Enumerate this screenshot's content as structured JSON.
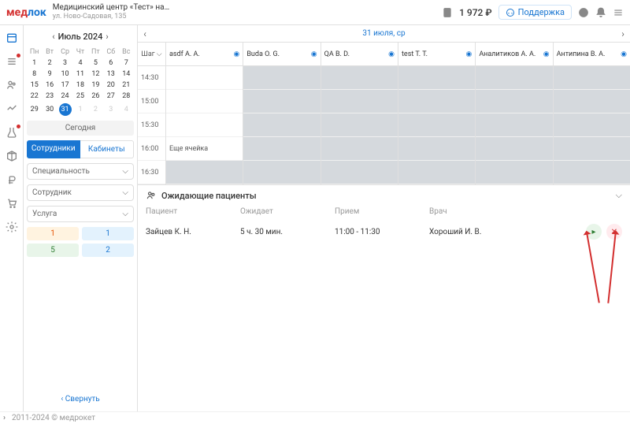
{
  "header": {
    "logo_med": "мед",
    "logo_lok": "лок",
    "clinic_name": "Медицинский центр «Тест» на ...",
    "clinic_addr": "ул. Ново-Садовая, 135",
    "balance": "1 972 ₽",
    "support": "Поддержка"
  },
  "month": {
    "title": "Июль 2024",
    "dow": [
      "Пн",
      "Вт",
      "Ср",
      "Чт",
      "Пт",
      "Сб",
      "Вс"
    ],
    "weeks": [
      [
        "1",
        "2",
        "3",
        "4",
        "5",
        "6",
        "7"
      ],
      [
        "8",
        "9",
        "10",
        "11",
        "12",
        "13",
        "14"
      ],
      [
        "15",
        "16",
        "17",
        "18",
        "19",
        "20",
        "21"
      ],
      [
        "22",
        "23",
        "24",
        "25",
        "26",
        "27",
        "28"
      ],
      [
        "29",
        "30",
        "31",
        "1",
        "2",
        "3",
        "4"
      ]
    ],
    "today_btn": "Сегодня",
    "selected": "31"
  },
  "tabs": {
    "emp": "Сотрудники",
    "rooms": "Кабинеты"
  },
  "selects": {
    "spec": "Специальность",
    "emp": "Сотрудник",
    "svc": "Услуга"
  },
  "pills": {
    "p1": "1",
    "p2": "1",
    "p3": "5",
    "p4": "2"
  },
  "collapse": "Свернуть",
  "expand_icon": "›",
  "datebar": {
    "date": "31 июля, ср"
  },
  "step_label": "Шаг",
  "staff": [
    "asdf А. А.",
    "Buda О. G.",
    "QA B. D.",
    "test T. T.",
    "Аналитиков А. А.",
    "Антипина В. А."
  ],
  "times": [
    "14:30",
    "15:00",
    "15:30",
    "16:00",
    "16:30"
  ],
  "cell_label": "Еще ячейка",
  "waiting": {
    "title": "Ожидающие пациенты",
    "cols": {
      "patient": "Пациент",
      "waits": "Ожидает",
      "appt": "Прием",
      "doc": "Врач"
    },
    "row": {
      "patient": "Зайцев К. Н.",
      "waits": "5 ч. 30 мин.",
      "appt": "11:00 - 11:30",
      "doc": "Хороший И. В."
    }
  },
  "footer": "2011-2024 © медрокет"
}
